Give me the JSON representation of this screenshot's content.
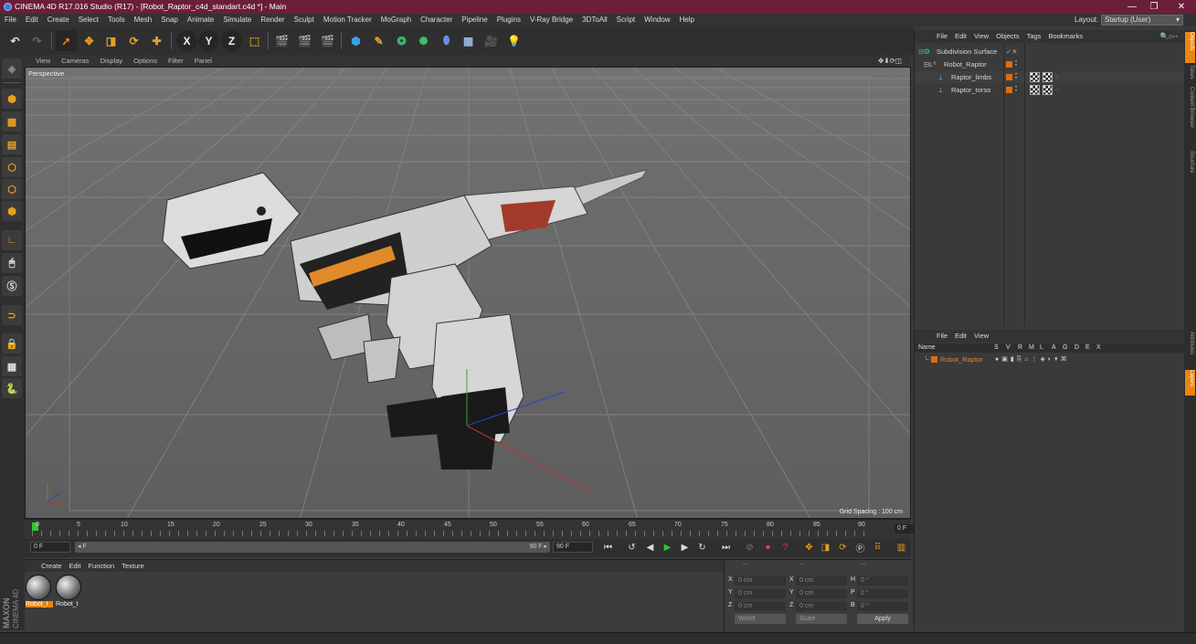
{
  "window": {
    "title": "CINEMA 4D R17.016 Studio (R17) - [Robot_Raptor_c4d_standart.c4d *] - Main",
    "minimize": "—",
    "maximize": "❐",
    "close": "✕"
  },
  "menu": [
    "File",
    "Edit",
    "Create",
    "Select",
    "Tools",
    "Mesh",
    "Snap",
    "Animate",
    "Simulate",
    "Render",
    "Sculpt",
    "Motion Tracker",
    "MoGraph",
    "Character",
    "Pipeline",
    "Plugins",
    "V-Ray Bridge",
    "3DToAll",
    "Script",
    "Window",
    "Help"
  ],
  "layout": {
    "label": "Layout:",
    "value": "Startup (User)"
  },
  "toolbar": {
    "x": "X",
    "y": "Y",
    "z": "Z"
  },
  "viewport": {
    "menu": [
      "View",
      "Cameras",
      "Display",
      "Options",
      "Filter",
      "Panel"
    ],
    "label": "Perspective",
    "grid_spacing": "Grid Spacing : 100 cm"
  },
  "timeline": {
    "ticks": [
      "0",
      "5",
      "10",
      "15",
      "20",
      "25",
      "30",
      "35",
      "40",
      "45",
      "50",
      "55",
      "60",
      "65",
      "70",
      "75",
      "80",
      "85",
      "90"
    ],
    "current_frame": "0 F"
  },
  "transport": {
    "start": "0 F",
    "slider_start": "◂ F",
    "slider_end": "90 F ▸",
    "end": "90 F"
  },
  "materials": {
    "menu": [
      "Create",
      "Edit",
      "Function",
      "Texture"
    ],
    "items": [
      {
        "name": "Robot_l"
      },
      {
        "name": "Robot_t"
      }
    ]
  },
  "coords": {
    "header": [
      "--",
      "--",
      "--"
    ],
    "rows": [
      {
        "a": "X",
        "v1": "0 cm",
        "b": "X",
        "v2": "0 cm",
        "c": "H",
        "v3": "0 °"
      },
      {
        "a": "Y",
        "v1": "0 cm",
        "b": "Y",
        "v2": "0 cm",
        "c": "P",
        "v3": "0 °"
      },
      {
        "a": "Z",
        "v1": "0 cm",
        "b": "Z",
        "v2": "0 cm",
        "c": "B",
        "v3": "0 °"
      }
    ],
    "mode1": "World",
    "mode2": "Scale",
    "apply": "Apply"
  },
  "brand": {
    "line1": "MAXON",
    "line2": "CINEMA 4D"
  },
  "objects_panel": {
    "menu": [
      "File",
      "Edit",
      "View",
      "Objects",
      "Tags",
      "Bookmarks"
    ],
    "items": [
      {
        "name": "Subdivision Surface"
      },
      {
        "name": "Robot_Raptor"
      },
      {
        "name": "Raptor_limbs"
      },
      {
        "name": "Raptor_torso"
      }
    ]
  },
  "layers_panel": {
    "menu": [
      "File",
      "Edit",
      "View"
    ],
    "columns": {
      "name": "Name",
      "flags": [
        "S",
        "V",
        "R",
        "M",
        "L",
        "A",
        "G",
        "D",
        "E",
        "X"
      ]
    },
    "layer": "Robot_Raptor"
  },
  "side_tabs": [
    "Objects",
    "Takes",
    "Content Browser",
    "Structure",
    "Attributes",
    "Layers"
  ],
  "colors": {
    "accent": "#e8860e",
    "title_bar": "#6b1e3a"
  }
}
